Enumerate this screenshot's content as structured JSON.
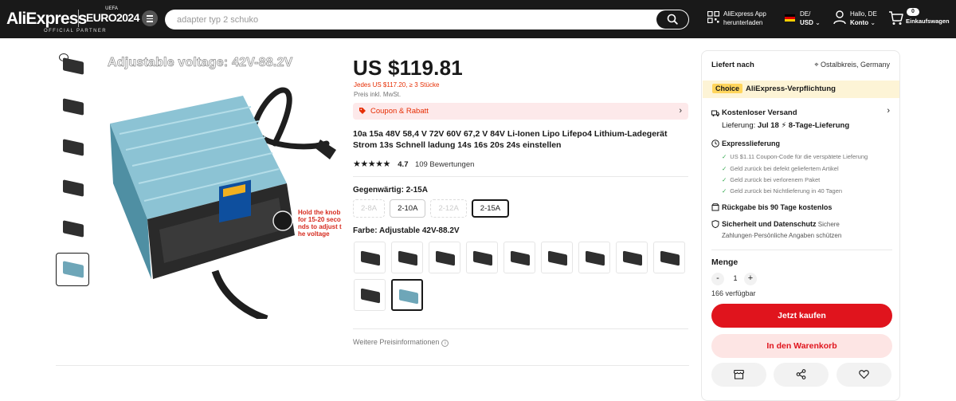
{
  "header": {
    "logo": "AliExpress",
    "uefa": "UEFA",
    "euro": "EURO2024",
    "partner": "OFFICIAL PARTNER",
    "search_placeholder": "adapter typ 2 schuko",
    "app_line1": "AliExpress App",
    "app_line2": "herunterladen",
    "lang_line1": "DE/",
    "lang_line2": "USD",
    "account_line1": "Hallo, DE",
    "account_line2": "Konto",
    "cart_count": "0",
    "cart_label": "Einkaufswagen"
  },
  "gallery": {
    "image_caption": "Adjustable voltage: 42V-88.2V",
    "image_note": "Hold the knob for 15-20 seco nds to adjust t he voltage",
    "display_reading": "15.0A"
  },
  "product": {
    "price": "US $119.81",
    "bulk_price": "Jedes US $117.20, ≥ 3 Stücke",
    "tax_note": "Preis inkl. MwSt.",
    "coupon_label": "Coupon & Rabatt",
    "title": "10a 15a 48V 58,4 V 72V 60V 67,2 V 84V Li-Ionen Lipo Lifepo4 Lithium-Ladegerät Strom 13s Schnell ladung 14s 16s 20s 24s einstellen",
    "stars": "★★★★★",
    "rating": "4.7",
    "reviews": "109 Bewertungen",
    "size_label": "Gegenwärtig: 2-15A",
    "sizes": [
      {
        "label": "2-8A",
        "state": "disabled"
      },
      {
        "label": "2-10A",
        "state": "normal"
      },
      {
        "label": "2-12A",
        "state": "disabled"
      },
      {
        "label": "2-15A",
        "state": "selected"
      }
    ],
    "color_label": "Farbe: Adjustable 42V-88.2V",
    "more_price_info": "Weitere Preisinformationen"
  },
  "panel": {
    "delivery_title": "Liefert nach",
    "location": "Ostalbkreis, Germany",
    "choice_badge": "Choice",
    "choice_text": "AliExpress-Verpflichtung",
    "shipping": "Kostenloser Versand",
    "delivery_prefix": "Lieferung: ",
    "delivery_date": "Jul 18",
    "delivery_days": "8-Tage-Lieferung",
    "express": "Expresslieferung",
    "express_items": [
      "US $1.11 Coupon-Code für die verspätete Lieferung",
      "Geld zurück bei defekt geliefertem Artikel",
      "Geld zurück bei verlorenem Paket",
      "Geld zurück bei Nichtlieferung in 40 Tagen"
    ],
    "returns": "Rückgabe bis 90 Tage kostenlos",
    "security_bold": "Sicherheit und Datenschutz",
    "security_rest": " Sichere",
    "security_line2": "Zahlungen·Persönliche Angaben schützen",
    "qty_label": "Menge",
    "qty_minus": "-",
    "qty_value": "1",
    "qty_plus": "+",
    "available": "166 verfügbar",
    "buy_now": "Jetzt kaufen",
    "add_to_cart": "In den Warenkorb"
  }
}
